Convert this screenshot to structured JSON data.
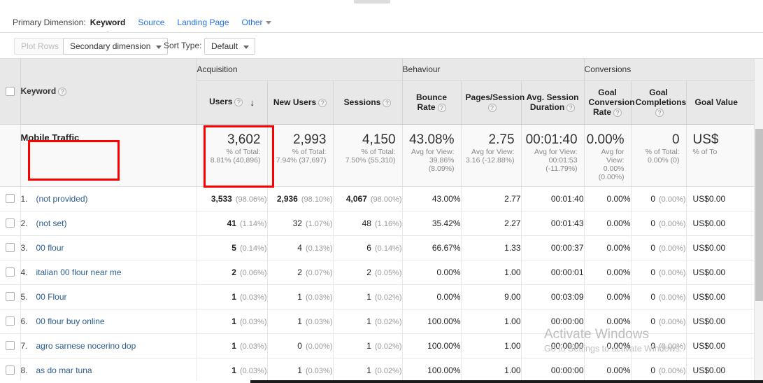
{
  "primary_dimension": {
    "label": "Primary Dimension:",
    "items": [
      {
        "label": "Keyword",
        "active": true
      },
      {
        "label": "Source",
        "active": false
      },
      {
        "label": "Landing Page",
        "active": false
      },
      {
        "label": "Other",
        "active": false,
        "caret": true
      }
    ]
  },
  "controls": {
    "plot_rows": "Plot Rows",
    "secondary_dimension": "Secondary dimension",
    "sort_type_label": "Sort Type:",
    "sort_type_value": "Default",
    "search_value": "",
    "search_placeholder": "",
    "search_icon": "search-icon",
    "advanced": "advanced",
    "view_toggles": [
      {
        "name": "table-view-icon",
        "active": true
      },
      {
        "name": "pie-chart-view-icon",
        "active": false
      },
      {
        "name": "performance-view-icon",
        "active": false
      },
      {
        "name": "comparison-view-icon",
        "active": false
      },
      {
        "name": "terms-cloud-view-icon",
        "active": false
      },
      {
        "name": "pivot-view-icon",
        "active": false
      }
    ]
  },
  "table": {
    "groups": [
      {
        "label": "Acquisition",
        "span": 3
      },
      {
        "label": "Behaviour",
        "span": 3
      },
      {
        "label": "Conversions",
        "span": 3
      }
    ],
    "dimension_header": "Keyword",
    "columns": [
      {
        "label": "Users",
        "sorted": true,
        "sort_dir": "desc"
      },
      {
        "label": "New Users",
        "sorted": false
      },
      {
        "label": "Sessions",
        "sorted": false
      },
      {
        "label": "Bounce Rate",
        "sorted": false
      },
      {
        "label": "Pages/Session",
        "sorted": false
      },
      {
        "label": "Avg. Session Duration",
        "sorted": false
      },
      {
        "label": "Goal Conversion Rate",
        "sorted": false
      },
      {
        "label": "Goal Completions",
        "sorted": false
      },
      {
        "label": "Goal Value",
        "sorted": false,
        "truncated": true
      }
    ],
    "summary": {
      "name": "Mobile Traffic",
      "cells": [
        {
          "value": "3,602",
          "sub": [
            "% of Total:",
            "8.81% (40,896)"
          ]
        },
        {
          "value": "2,993",
          "sub": [
            "% of Total:",
            "7.94% (37,697)"
          ]
        },
        {
          "value": "4,150",
          "sub": [
            "% of Total:",
            "7.50% (55,310)"
          ]
        },
        {
          "value": "43.08%",
          "sub": [
            "Avg for View:",
            "39.86%",
            "(8.09%)"
          ]
        },
        {
          "value": "2.75",
          "sub": [
            "Avg for View:",
            "3.16 (-12.88%)"
          ]
        },
        {
          "value": "00:01:40",
          "sub": [
            "Avg for View:",
            "00:01:53",
            "(-11.79%)"
          ]
        },
        {
          "value": "0.00%",
          "sub": [
            "Avg for",
            "View:",
            "0.00%",
            "(0.00%)"
          ]
        },
        {
          "value": "0",
          "sub": [
            "% of Total:",
            "0.00% (0)"
          ]
        },
        {
          "value": "US$",
          "sub": [
            "% of To"
          ]
        }
      ]
    },
    "rows": [
      {
        "index": "1.",
        "keyword": "(not provided)",
        "users": "3,533",
        "users_pct": "(98.06%)",
        "users_bold": true,
        "new_users": "2,936",
        "new_users_pct": "(98.10%)",
        "new_users_bold": true,
        "sessions": "4,067",
        "sessions_pct": "(98.00%)",
        "sessions_bold": true,
        "bounce_rate": "43.00%",
        "pages_session": "2.77",
        "avg_duration": "00:01:40",
        "goal_rate": "0.00%",
        "goal_completions": "0",
        "goal_completions_pct": "(0.00%)",
        "goal_value": "US$0.00"
      },
      {
        "index": "2.",
        "keyword": "(not set)",
        "users": "41",
        "users_pct": "(1.14%)",
        "users_bold": true,
        "new_users": "32",
        "new_users_pct": "(1.07%)",
        "new_users_bold": false,
        "sessions": "48",
        "sessions_pct": "(1.16%)",
        "sessions_bold": false,
        "bounce_rate": "35.42%",
        "pages_session": "2.27",
        "avg_duration": "00:01:43",
        "goal_rate": "0.00%",
        "goal_completions": "0",
        "goal_completions_pct": "(0.00%)",
        "goal_value": "US$0.00"
      },
      {
        "index": "3.",
        "keyword": "00 flour",
        "users": "5",
        "users_pct": "(0.14%)",
        "users_bold": true,
        "new_users": "4",
        "new_users_pct": "(0.13%)",
        "new_users_bold": false,
        "sessions": "6",
        "sessions_pct": "(0.14%)",
        "sessions_bold": false,
        "bounce_rate": "66.67%",
        "pages_session": "1.33",
        "avg_duration": "00:00:37",
        "goal_rate": "0.00%",
        "goal_completions": "0",
        "goal_completions_pct": "(0.00%)",
        "goal_value": "US$0.00"
      },
      {
        "index": "4.",
        "keyword": "italian 00 flour near me",
        "users": "2",
        "users_pct": "(0.06%)",
        "users_bold": true,
        "new_users": "2",
        "new_users_pct": "(0.07%)",
        "new_users_bold": false,
        "sessions": "2",
        "sessions_pct": "(0.05%)",
        "sessions_bold": false,
        "bounce_rate": "0.00%",
        "pages_session": "1.00",
        "avg_duration": "00:00:01",
        "goal_rate": "0.00%",
        "goal_completions": "0",
        "goal_completions_pct": "(0.00%)",
        "goal_value": "US$0.00"
      },
      {
        "index": "5.",
        "keyword": "00 Flour",
        "users": "1",
        "users_pct": "(0.03%)",
        "users_bold": true,
        "new_users": "1",
        "new_users_pct": "(0.03%)",
        "new_users_bold": false,
        "sessions": "1",
        "sessions_pct": "(0.02%)",
        "sessions_bold": false,
        "bounce_rate": "0.00%",
        "pages_session": "9.00",
        "avg_duration": "00:03:09",
        "goal_rate": "0.00%",
        "goal_completions": "0",
        "goal_completions_pct": "(0.00%)",
        "goal_value": "US$0.00"
      },
      {
        "index": "6.",
        "keyword": "00 flour buy online",
        "users": "1",
        "users_pct": "(0.03%)",
        "users_bold": true,
        "new_users": "1",
        "new_users_pct": "(0.03%)",
        "new_users_bold": false,
        "sessions": "1",
        "sessions_pct": "(0.02%)",
        "sessions_bold": false,
        "bounce_rate": "100.00%",
        "pages_session": "1.00",
        "avg_duration": "00:00:00",
        "goal_rate": "0.00%",
        "goal_completions": "0",
        "goal_completions_pct": "(0.00%)",
        "goal_value": "US$0.00"
      },
      {
        "index": "7.",
        "keyword": "agro sarnese nocerino dop",
        "users": "1",
        "users_pct": "(0.03%)",
        "users_bold": true,
        "new_users": "0",
        "new_users_pct": "(0.00%)",
        "new_users_bold": false,
        "sessions": "1",
        "sessions_pct": "(0.02%)",
        "sessions_bold": false,
        "bounce_rate": "100.00%",
        "pages_session": "1.00",
        "avg_duration": "00:00:00",
        "goal_rate": "0.00%",
        "goal_completions": "0",
        "goal_completions_pct": "(0.00%)",
        "goal_value": "US$0.00"
      },
      {
        "index": "8.",
        "keyword": "as do mar tuna",
        "users": "1",
        "users_pct": "(0.03%)",
        "users_bold": true,
        "new_users": "1",
        "new_users_pct": "(0.03%)",
        "new_users_bold": false,
        "sessions": "1",
        "sessions_pct": "(0.02%)",
        "sessions_bold": false,
        "bounce_rate": "100.00%",
        "pages_session": "1.00",
        "avg_duration": "00:00:00",
        "goal_rate": "0.00%",
        "goal_completions": "0",
        "goal_completions_pct": "(0.00%)",
        "goal_value": "US$0.00"
      }
    ]
  },
  "annotations": {
    "highlight_color": "#ff0000",
    "boxes": [
      {
        "name": "segment-name-highlight",
        "target": "Mobile Traffic"
      },
      {
        "name": "users-total-highlight",
        "target": "3,602"
      }
    ]
  },
  "watermark": {
    "title": "Activate Windows",
    "subtitle": "Go to Settings to activate Windows."
  }
}
